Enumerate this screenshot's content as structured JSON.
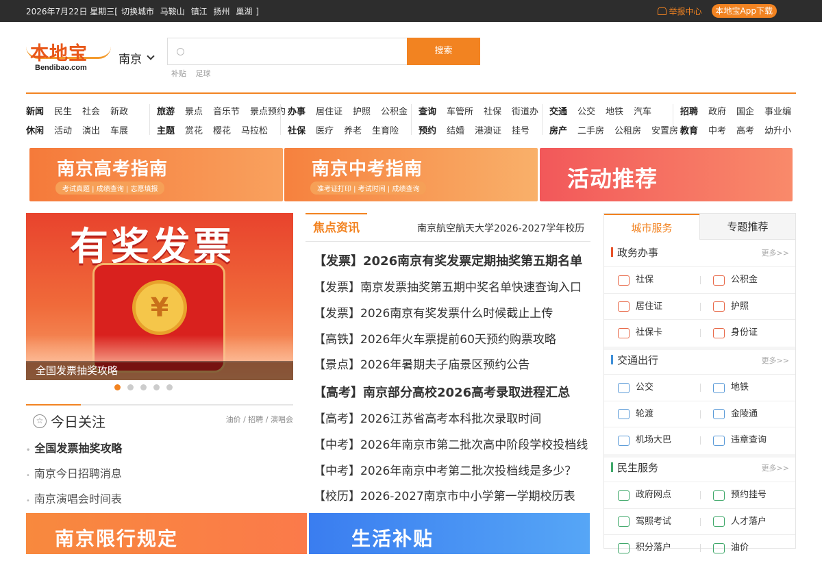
{
  "topbar": {
    "date": "2026年7月22日 星期三[",
    "switch": "切换城市",
    "cities": [
      "马鞍山",
      "镇江",
      "扬州",
      "巢湖"
    ],
    "close": "]",
    "report": "举报中心",
    "app": "本地宝App下载"
  },
  "logo": {
    "cn": "本地宝",
    "en": "Bendibao.com"
  },
  "city": "南京",
  "search": {
    "placeholder": "",
    "button": "搜索",
    "hot": [
      "补贴",
      "足球"
    ]
  },
  "nav": [
    {
      "row1": [
        "新闻",
        "民生",
        "社会",
        "新政"
      ],
      "row2": [
        "休闲",
        "活动",
        "演出",
        "车展"
      ]
    },
    {
      "row1": [
        "旅游",
        "景点",
        "音乐节",
        "景点预约"
      ],
      "row2": [
        "主题",
        "赏花",
        "樱花",
        "马拉松"
      ]
    },
    {
      "row1": [
        "办事",
        "居住证",
        "护照",
        "公积金"
      ],
      "row2": [
        "社保",
        "医疗",
        "养老",
        "生育险"
      ]
    },
    {
      "row1": [
        "查询",
        "车管所",
        "社保",
        "街道办"
      ],
      "row2": [
        "预约",
        "结婚",
        "港澳证",
        "挂号"
      ]
    },
    {
      "row1": [
        "交通",
        "公交",
        "地铁",
        "汽车"
      ],
      "row2": [
        "房产",
        "二手房",
        "公租房",
        "安置房"
      ]
    },
    {
      "row1": [
        "招聘",
        "政府",
        "国企",
        "事业编"
      ],
      "row2": [
        "教育",
        "中考",
        "高考",
        "幼升小"
      ]
    }
  ],
  "banners": [
    {
      "title": "南京高考指南",
      "sub": "考试真题 | 成绩查询 | 志愿填报"
    },
    {
      "title": "南京中考指南",
      "sub": "准考证打印 | 考试时间 | 成绩查询"
    },
    {
      "title": "活动推荐",
      "sub": ""
    }
  ],
  "slider": {
    "headline": "有奖发票",
    "coin": "¥",
    "caption": "全国发票抽奖攻略",
    "dots": 5,
    "active": 0
  },
  "today": {
    "title": "今日关注",
    "tags": "油价 / 招聘 / 演唱会",
    "items": [
      "全国发票抽奖攻略",
      "南京今日招聘消息",
      "南京演唱会时间表"
    ]
  },
  "bottom_banners": [
    "南京限行规定",
    "生活补贴"
  ],
  "news_tab": "焦点资讯",
  "marquee": "南京航空航天大学2026-2027学年校历",
  "news": [
    "【发票】2026南京有奖发票定期抽奖第五期名单",
    "【发票】南京发票抽奖第五期中奖名单快速查询入口",
    "【发票】2026南京有奖发票什么时候截止上传",
    "【高铁】2026年火车票提前60天预约购票攻略",
    "【景点】2026年暑期夫子庙景区预约公告",
    "【高考】南京部分高校2026高考录取进程汇总",
    "【高考】2026江苏省高考本科批次录取时间",
    "【中考】2026年南京市第二批次高中阶段学校投档线",
    "【中考】2026年南京中考第二批次投档线是多少？",
    "【校历】2026-2027南京市中小学第一学期校历表"
  ],
  "side": {
    "tabs": [
      "城市服务",
      "专题推荐"
    ],
    "more": "更多>>",
    "sections": [
      {
        "title": "政务办事",
        "color": "#e8532a",
        "rows": [
          [
            "社保",
            "公积金"
          ],
          [
            "居住证",
            "护照"
          ],
          [
            "社保卡",
            "身份证"
          ]
        ]
      },
      {
        "title": "交通出行",
        "color": "#3f8fd8",
        "rows": [
          [
            "公交",
            "地铁"
          ],
          [
            "轮渡",
            "金陵通"
          ],
          [
            "机场大巴",
            "违章查询"
          ]
        ]
      },
      {
        "title": "民生服务",
        "color": "#3fa86a",
        "rows": [
          [
            "政府网点",
            "预约挂号"
          ],
          [
            "驾照考试",
            "人才落户"
          ],
          [
            "积分落户",
            "油价"
          ]
        ]
      }
    ]
  },
  "colors": {
    "accent": "#f28321",
    "topbar": "#2d2d2d"
  }
}
